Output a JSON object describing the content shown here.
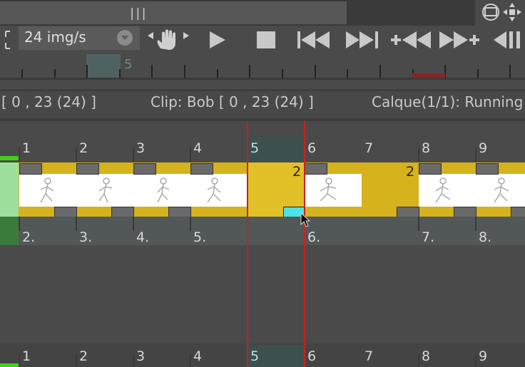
{
  "toolbar": {
    "fps_value": "24 img/s",
    "icons": [
      "hand-icon",
      "play-icon",
      "stop-icon",
      "go-start-icon",
      "go-end-icon",
      "add-frame-before-icon",
      "add-frame-after-icon",
      "step-back-icon"
    ]
  },
  "ruler": {
    "current_frame": "5"
  },
  "info": {
    "range": "[ 0 , 23  (24) ]",
    "clip": "Clip: Bob [ 0 , 23  (24) ]",
    "layer": "Calque(1/1): Running"
  },
  "frames": [
    "1",
    "2",
    "3",
    "4",
    "5",
    "6",
    "7",
    "8",
    "9"
  ],
  "holds": [
    "2",
    "2"
  ],
  "lower_labels": [
    "2.",
    "3.",
    "4.",
    "5.",
    "6.",
    "7.",
    "8."
  ],
  "colors": {
    "track": "#d6b21c",
    "selected_cell": "#4ee3e8",
    "playhead": "#cc2020",
    "onion": "#44d01a"
  }
}
